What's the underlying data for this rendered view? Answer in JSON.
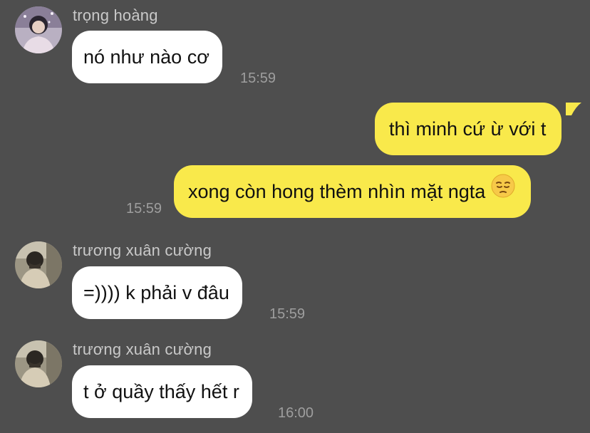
{
  "colors": {
    "background": "#4e4e4e",
    "incoming_bubble": "#ffffff",
    "outgoing_bubble": "#f9e94b",
    "sender_text": "#c9c9c9",
    "time_text": "#9e9e9e"
  },
  "messages": [
    {
      "sender": "trọng hoàng",
      "text": "nó như nào cơ",
      "time": "15:59",
      "direction": "incoming"
    },
    {
      "text": "thì minh cứ ừ với t",
      "direction": "outgoing"
    },
    {
      "text": "xong còn hong thèm nhìn mặt ngta",
      "emoji": "pensive-face-icon",
      "time": "15:59",
      "direction": "outgoing"
    },
    {
      "sender": "trương xuân cường",
      "text": "=)))) k phải v đâu",
      "time": "15:59",
      "direction": "incoming"
    },
    {
      "sender": "trương xuân cường",
      "text": "t ở quầy thấy hết r",
      "time": "16:00",
      "direction": "incoming"
    }
  ]
}
